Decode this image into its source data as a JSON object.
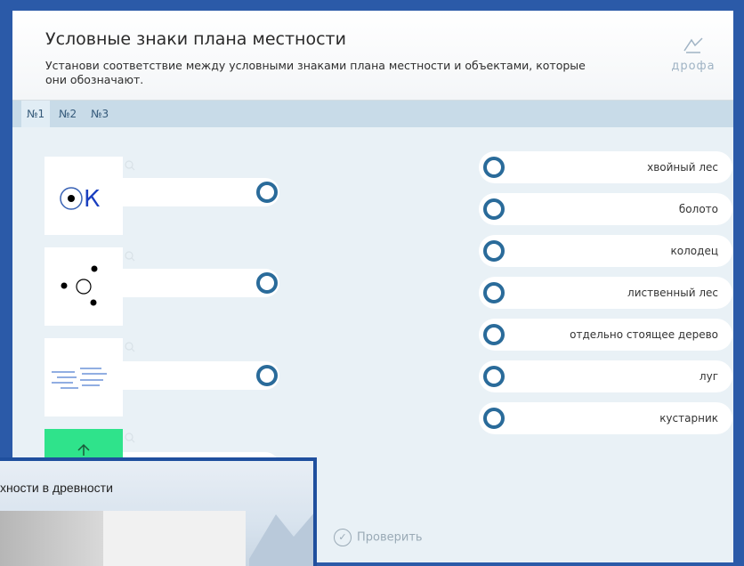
{
  "header": {
    "title": "Условные знаки плана местности",
    "subtitle": "Установи соответствие между условными знаками плана местности и объектами, которые они обозначают.",
    "logo_text": "дрофа"
  },
  "tabs": [
    {
      "label": "№1",
      "active": true
    },
    {
      "label": "№2",
      "active": false
    },
    {
      "label": "№3",
      "active": false
    }
  ],
  "left_items": [
    {
      "icon": "well-symbol-icon",
      "symbol_text": "К"
    },
    {
      "icon": "separate-tree-symbol-icon"
    },
    {
      "icon": "meadow-symbol-icon"
    },
    {
      "icon": "arrow-up-icon"
    }
  ],
  "right_items": [
    {
      "label": "хвойный лес"
    },
    {
      "label": "болото"
    },
    {
      "label": "колодец"
    },
    {
      "label": "лиственный лес"
    },
    {
      "label": "отдельно стоящее дерево"
    },
    {
      "label": "луг"
    },
    {
      "label": "кустарник"
    }
  ],
  "check_button": "Проверить",
  "overlay": {
    "title_fragment": "хности в древности"
  },
  "colors": {
    "accent_ring": "#2a6b9a",
    "green_tile": "#2fe38b",
    "tab_bar": "#c8dbe8",
    "window_frame": "#2b5aa8"
  }
}
